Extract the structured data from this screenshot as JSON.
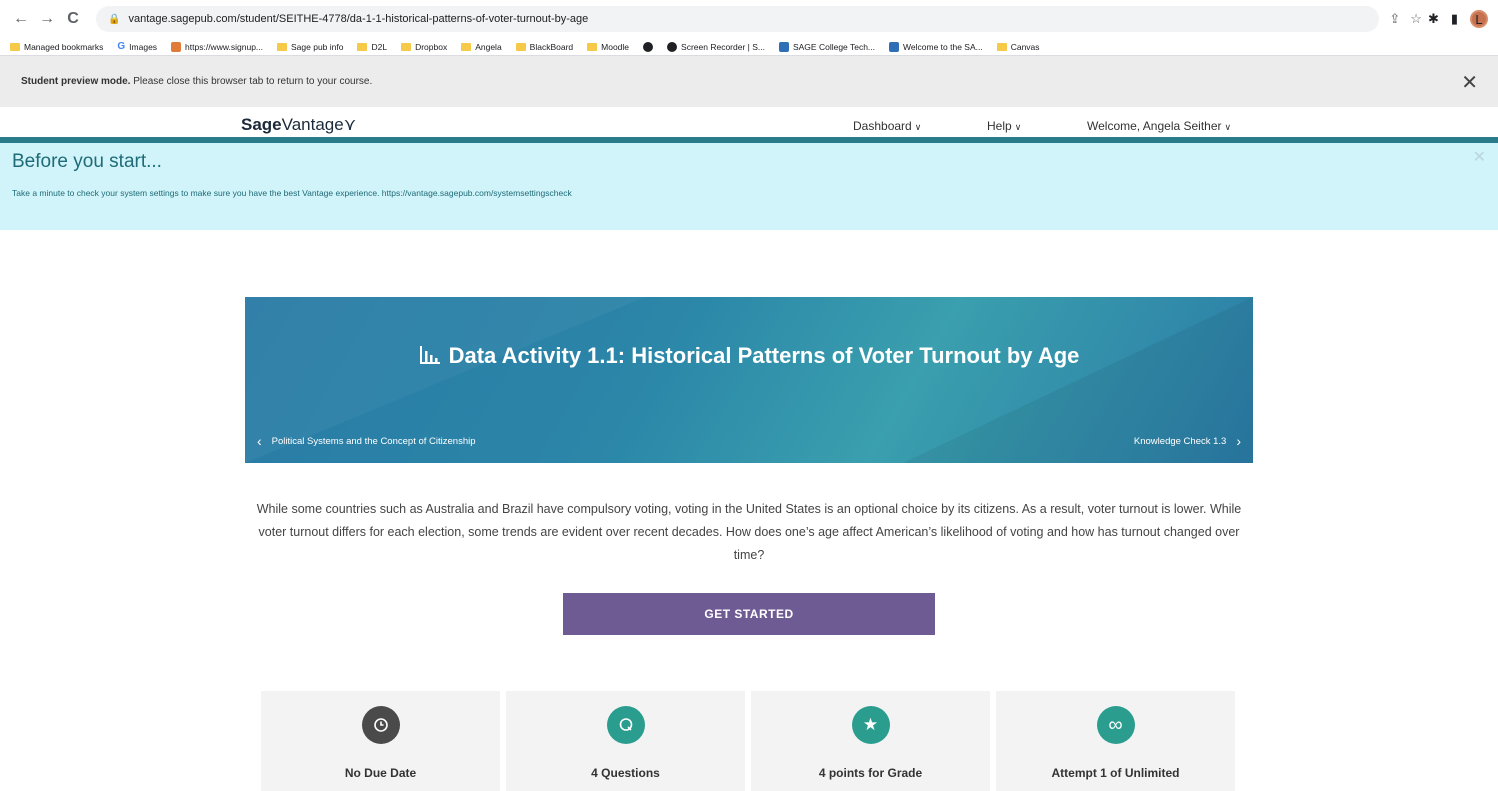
{
  "browser": {
    "url": "vantage.sagepub.com/student/SEITHE-4778/da-1-1-historical-patterns-of-voter-turnout-by-age",
    "avatar_letter": "L",
    "bookmarks": [
      "Managed bookmarks",
      "Images",
      "https://www.signup...",
      "Sage pub info",
      "D2L",
      "Dropbox",
      "Angela",
      "BlackBoard",
      "Moodle",
      "",
      "Screen Recorder | S...",
      "SAGE College Tech...",
      "Welcome to the SA...",
      "Canvas"
    ]
  },
  "preview": {
    "bold": "Student preview mode.",
    "text": " Please close this browser tab to return to your course."
  },
  "header": {
    "logo_bold": "Sage",
    "logo_rest": "Vantage",
    "dashboard": "Dashboard",
    "help": "Help",
    "welcome": "Welcome, Angela Seither"
  },
  "notice": {
    "title": "Before you start...",
    "text": "Take a minute to check your system settings to make sure you have the best Vantage experience. https://vantage.sagepub.com/systemsettingscheck"
  },
  "hero": {
    "title": "Data Activity 1.1: Historical Patterns of Voter Turnout by Age",
    "prev": "Political Systems and the Concept of Citizenship",
    "next": "Knowledge Check 1.3"
  },
  "description": "While some countries such as Australia and Brazil have compulsory voting, voting in the United States is an optional choice by its citizens. As a result, voter turnout is lower. While voter turnout differs for each election, some trends are evident over recent decades. How does one’s age affect American’s likelihood of voting and how has turnout changed over time?",
  "cta": "GET STARTED",
  "cards": [
    {
      "label": "No Due Date",
      "icon": "clock-icon",
      "color": "#4a4a4a"
    },
    {
      "label": "4 Questions",
      "icon": "q-icon",
      "color": "#2a9d8f"
    },
    {
      "label": "4 points for Grade",
      "icon": "star-icon",
      "color": "#2a9d8f"
    },
    {
      "label": "Attempt 1 of Unlimited",
      "icon": "infinity-icon",
      "color": "#2a9d8f"
    }
  ]
}
